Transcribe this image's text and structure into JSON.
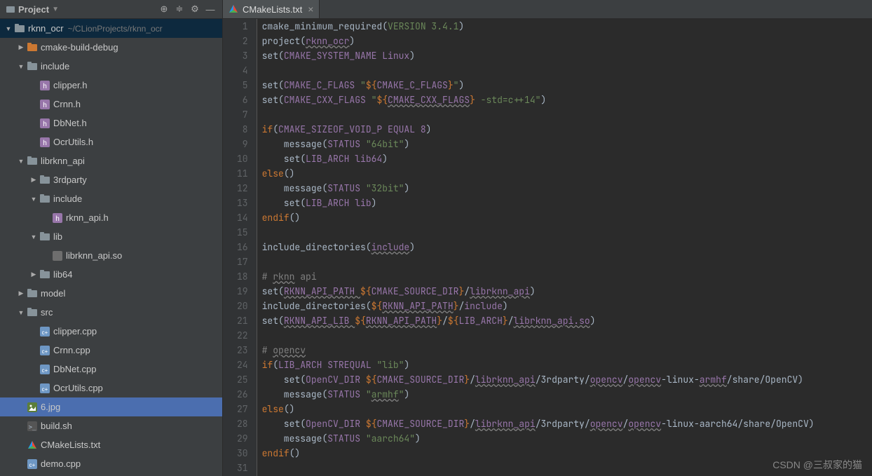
{
  "sidebar": {
    "title": "Project",
    "root": {
      "name": "rknn_ocr",
      "path": "~/CLionProjects/rknn_ocr"
    }
  },
  "tree": [
    {
      "d": 0,
      "exp": "down",
      "ico": "folder-mod",
      "lbl": "rknn_ocr",
      "path": "~/CLionProjects/rknn_ocr",
      "hl": true
    },
    {
      "d": 1,
      "exp": "right",
      "ico": "folder-orange",
      "lbl": "cmake-build-debug"
    },
    {
      "d": 1,
      "exp": "down",
      "ico": "folder",
      "lbl": "include"
    },
    {
      "d": 2,
      "exp": "",
      "ico": "h",
      "lbl": "clipper.h"
    },
    {
      "d": 2,
      "exp": "",
      "ico": "h",
      "lbl": "Crnn.h"
    },
    {
      "d": 2,
      "exp": "",
      "ico": "h",
      "lbl": "DbNet.h"
    },
    {
      "d": 2,
      "exp": "",
      "ico": "h",
      "lbl": "OcrUtils.h"
    },
    {
      "d": 1,
      "exp": "down",
      "ico": "folder",
      "lbl": "librknn_api"
    },
    {
      "d": 2,
      "exp": "right",
      "ico": "folder",
      "lbl": "3rdparty"
    },
    {
      "d": 2,
      "exp": "down",
      "ico": "folder",
      "lbl": "include"
    },
    {
      "d": 3,
      "exp": "",
      "ico": "h",
      "lbl": "rknn_api.h"
    },
    {
      "d": 2,
      "exp": "down",
      "ico": "folder",
      "lbl": "lib"
    },
    {
      "d": 3,
      "exp": "",
      "ico": "any",
      "lbl": "librknn_api.so"
    },
    {
      "d": 2,
      "exp": "right",
      "ico": "folder",
      "lbl": "lib64"
    },
    {
      "d": 1,
      "exp": "right",
      "ico": "folder",
      "lbl": "model"
    },
    {
      "d": 1,
      "exp": "down",
      "ico": "folder",
      "lbl": "src"
    },
    {
      "d": 2,
      "exp": "",
      "ico": "cpp",
      "lbl": "clipper.cpp"
    },
    {
      "d": 2,
      "exp": "",
      "ico": "cpp",
      "lbl": "Crnn.cpp"
    },
    {
      "d": 2,
      "exp": "",
      "ico": "cpp",
      "lbl": "DbNet.cpp"
    },
    {
      "d": 2,
      "exp": "",
      "ico": "cpp",
      "lbl": "OcrUtils.cpp"
    },
    {
      "d": 1,
      "exp": "",
      "ico": "img",
      "lbl": "6.jpg",
      "sel": true
    },
    {
      "d": 1,
      "exp": "",
      "ico": "sh",
      "lbl": "build.sh"
    },
    {
      "d": 1,
      "exp": "",
      "ico": "cmake",
      "lbl": "CMakeLists.txt"
    },
    {
      "d": 1,
      "exp": "",
      "ico": "cpp",
      "lbl": "demo.cpp"
    }
  ],
  "tab": {
    "label": "CMakeLists.txt"
  },
  "code": [
    {
      "t": [
        [
          "n",
          "cmake_minimum_required("
        ],
        [
          "s",
          "VERSION 3.4.1"
        ],
        [
          "n",
          ")"
        ]
      ]
    },
    {
      "t": [
        [
          "n",
          "project("
        ],
        [
          "v",
          "rknn_ocr",
          "u"
        ],
        [
          "n",
          ")"
        ]
      ]
    },
    {
      "t": [
        [
          "n",
          "set("
        ],
        [
          "v",
          "CMAKE_SYSTEM_NAME Linux"
        ],
        [
          "n",
          ")"
        ]
      ]
    },
    {
      "t": []
    },
    {
      "t": [
        [
          "n",
          "set("
        ],
        [
          "v",
          "CMAKE_C_FLAGS "
        ],
        [
          "s",
          "\""
        ],
        [
          "k",
          "${"
        ],
        [
          "v",
          "CMAKE_C_FLAGS"
        ],
        [
          "k",
          "}"
        ],
        [
          "s",
          "\""
        ],
        [
          "n",
          ")"
        ]
      ]
    },
    {
      "t": [
        [
          "n",
          "set("
        ],
        [
          "v",
          "CMAKE_CXX_FLAGS "
        ],
        [
          "s",
          "\""
        ],
        [
          "k",
          "${"
        ],
        [
          "v",
          "CMAKE_CXX_FLAGS",
          "u"
        ],
        [
          "k",
          "}"
        ],
        [
          "s",
          " -std=c++14\""
        ],
        [
          "n",
          ")"
        ]
      ]
    },
    {
      "t": []
    },
    {
      "t": [
        [
          "k",
          "if"
        ],
        [
          "n",
          "("
        ],
        [
          "v",
          "CMAKE_SIZEOF_VOID_P EQUAL 8"
        ],
        [
          "n",
          ")"
        ]
      ]
    },
    {
      "t": [
        [
          "n",
          "    message("
        ],
        [
          "v",
          "STATUS "
        ],
        [
          "s",
          "\"64bit\""
        ],
        [
          "n",
          ")"
        ]
      ]
    },
    {
      "t": [
        [
          "n",
          "    set("
        ],
        [
          "v",
          "LIB_ARCH lib64"
        ],
        [
          "n",
          ")"
        ]
      ]
    },
    {
      "t": [
        [
          "k",
          "else"
        ],
        [
          "n",
          "()"
        ]
      ]
    },
    {
      "t": [
        [
          "n",
          "    message("
        ],
        [
          "v",
          "STATUS "
        ],
        [
          "s",
          "\"32bit\""
        ],
        [
          "n",
          ")"
        ]
      ]
    },
    {
      "t": [
        [
          "n",
          "    set("
        ],
        [
          "v",
          "LIB_ARCH lib"
        ],
        [
          "n",
          ")"
        ]
      ]
    },
    {
      "t": [
        [
          "k",
          "endif"
        ],
        [
          "n",
          "()"
        ]
      ]
    },
    {
      "t": []
    },
    {
      "t": [
        [
          "n",
          "include_directories("
        ],
        [
          "v",
          "include",
          "u"
        ],
        [
          "n",
          ")"
        ]
      ]
    },
    {
      "t": []
    },
    {
      "t": [
        [
          "c",
          "# "
        ],
        [
          "c",
          "rknn",
          "u"
        ],
        [
          "c",
          " api"
        ]
      ]
    },
    {
      "t": [
        [
          "n",
          "set("
        ],
        [
          "v",
          "RKNN_API_PATH ",
          "u"
        ],
        [
          "k",
          "${"
        ],
        [
          "v",
          "CMAKE_SOURCE_DIR"
        ],
        [
          "k",
          "}"
        ],
        [
          "n",
          "/"
        ],
        [
          "v",
          "librknn_api",
          "u"
        ],
        [
          "n",
          ")"
        ]
      ]
    },
    {
      "t": [
        [
          "n",
          "include_directories("
        ],
        [
          "k",
          "${"
        ],
        [
          "v",
          "RKNN_API_PATH",
          "u"
        ],
        [
          "k",
          "}"
        ],
        [
          "n",
          "/"
        ],
        [
          "v",
          "include"
        ],
        [
          "n",
          ")"
        ]
      ]
    },
    {
      "t": [
        [
          "n",
          "set("
        ],
        [
          "v",
          "RKNN_API_LIB ",
          "u"
        ],
        [
          "k",
          "${"
        ],
        [
          "v",
          "RKNN_API_PATH",
          "u"
        ],
        [
          "k",
          "}"
        ],
        [
          "n",
          "/"
        ],
        [
          "k",
          "${"
        ],
        [
          "v",
          "LIB_ARCH"
        ],
        [
          "k",
          "}"
        ],
        [
          "n",
          "/"
        ],
        [
          "v",
          "librknn_api.so",
          "u"
        ],
        [
          "n",
          ")"
        ]
      ]
    },
    {
      "t": []
    },
    {
      "t": [
        [
          "c",
          "# "
        ],
        [
          "c",
          "opencv",
          "u"
        ]
      ]
    },
    {
      "t": [
        [
          "k",
          "if"
        ],
        [
          "n",
          "("
        ],
        [
          "v",
          "LIB_ARCH STREQUAL "
        ],
        [
          "s",
          "\"lib\""
        ],
        [
          "n",
          ")"
        ]
      ]
    },
    {
      "t": [
        [
          "n",
          "    set("
        ],
        [
          "v",
          "OpenCV_DIR "
        ],
        [
          "k",
          "${"
        ],
        [
          "v",
          "CMAKE_SOURCE_DIR"
        ],
        [
          "k",
          "}"
        ],
        [
          "n",
          "/"
        ],
        [
          "v",
          "librknn_api",
          "u"
        ],
        [
          "n",
          "/3rdparty/"
        ],
        [
          "v",
          "opencv",
          "u"
        ],
        [
          "n",
          "/"
        ],
        [
          "v",
          "opencv",
          "u"
        ],
        [
          "n",
          "-linux-"
        ],
        [
          "v",
          "armhf",
          "u"
        ],
        [
          "n",
          "/share/OpenCV)"
        ]
      ]
    },
    {
      "t": [
        [
          "n",
          "    message("
        ],
        [
          "v",
          "STATUS "
        ],
        [
          "s",
          "\""
        ],
        [
          "s",
          "armhf",
          "u"
        ],
        [
          "s",
          "\""
        ],
        [
          "n",
          ")"
        ]
      ]
    },
    {
      "t": [
        [
          "k",
          "else"
        ],
        [
          "n",
          "()"
        ]
      ]
    },
    {
      "t": [
        [
          "n",
          "    set("
        ],
        [
          "v",
          "OpenCV_DIR "
        ],
        [
          "k",
          "${"
        ],
        [
          "v",
          "CMAKE_SOURCE_DIR"
        ],
        [
          "k",
          "}"
        ],
        [
          "n",
          "/"
        ],
        [
          "v",
          "librknn_api",
          "u"
        ],
        [
          "n",
          "/3rdparty/"
        ],
        [
          "v",
          "opencv",
          "u"
        ],
        [
          "n",
          "/"
        ],
        [
          "v",
          "opencv",
          "u"
        ],
        [
          "n",
          "-linux-aarch64/share/OpenCV)"
        ]
      ]
    },
    {
      "t": [
        [
          "n",
          "    message("
        ],
        [
          "v",
          "STATUS "
        ],
        [
          "s",
          "\"aarch64\""
        ],
        [
          "n",
          ")"
        ]
      ]
    },
    {
      "t": [
        [
          "k",
          "endif"
        ],
        [
          "n",
          "()"
        ]
      ]
    },
    {
      "t": []
    }
  ],
  "watermark": "CSDN @三叔家的猫"
}
